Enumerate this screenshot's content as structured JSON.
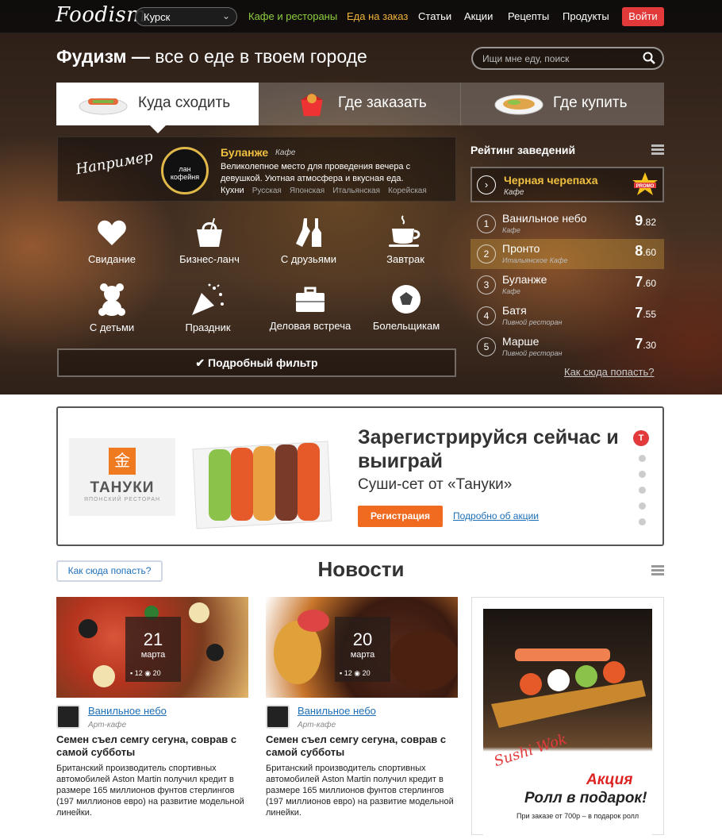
{
  "header": {
    "logo": "Foodism",
    "city": "Курск",
    "nav": [
      {
        "label": "Кафе и рестораны",
        "color": "#8ecf3e"
      },
      {
        "label": "Еда на заказ",
        "color": "#f0b43a"
      },
      {
        "label": "Статьи",
        "color": "#ffffff"
      },
      {
        "label": "Акции",
        "color": "#ffffff"
      },
      {
        "label": "Рецепты",
        "color": "#ffffff"
      },
      {
        "label": "Продукты",
        "color": "#ffffff"
      }
    ],
    "login": "Войти"
  },
  "hero": {
    "title_bold": "Фудизм —",
    "title_rest": " все о еде в твоем городе",
    "search_placeholder": "Ищи мне еду, поиск",
    "tabs": [
      {
        "label": "Куда сходить",
        "icon": "sushi-plate-icon"
      },
      {
        "label": "Где заказать",
        "icon": "takeout-box-icon"
      },
      {
        "label": "Где купить",
        "icon": "dish-plate-icon"
      }
    ],
    "example": {
      "hand_label": "Например",
      "badge_text": "лан кофейня",
      "name": "Буланже",
      "type": "Кафе",
      "desc": "Великолепное место для проведения вечера с девушкой. Уютная атмосфера и вкусная еда.",
      "cuisine_label": "Кухни",
      "cuisines": [
        "Русская",
        "Японская",
        "Итальянская",
        "Корейская"
      ]
    },
    "categories": [
      {
        "label": "Свидание",
        "icon": "heart-icon"
      },
      {
        "label": "Бизнес-ланч",
        "icon": "lunch-bag-icon"
      },
      {
        "label": "С друзьями",
        "icon": "bottles-icon"
      },
      {
        "label": "Завтрак",
        "icon": "coffee-cup-icon"
      },
      {
        "label": "С детьми",
        "icon": "teddy-bear-icon"
      },
      {
        "label": "Праздник",
        "icon": "party-popper-icon"
      },
      {
        "label": "Деловая встреча",
        "icon": "briefcase-icon"
      },
      {
        "label": "Болельщикам",
        "icon": "soccer-ball-icon"
      }
    ],
    "filter": "Подробный фильтр"
  },
  "rating": {
    "title": "Рейтинг заведений",
    "promo": {
      "name": "Черная черепаха",
      "type": "Кафе",
      "badge": "PROMO"
    },
    "rows": [
      {
        "rank": "1",
        "name": "Ванильное небо",
        "type": "Кафе",
        "score": "9",
        "dec": ".82"
      },
      {
        "rank": "2",
        "name": "Пронто",
        "type": "Итальянское Кафе",
        "score": "8",
        "dec": ".60"
      },
      {
        "rank": "3",
        "name": "Буланже",
        "type": "Кафе",
        "score": "7",
        "dec": ".60"
      },
      {
        "rank": "4",
        "name": "Батя",
        "type": "Пивной ресторан",
        "score": "7",
        "dec": ".55"
      },
      {
        "rank": "5",
        "name": "Марше",
        "type": "Пивной ресторан",
        "score": "7",
        "dec": ".30"
      }
    ],
    "howto": "Как сюда попасть?"
  },
  "banner": {
    "brand": "ТАНУКИ",
    "brand_sub": "ЯПОНСКИЙ РЕСТОРАН",
    "brand_glyph": "金",
    "title": "Зарегистрируйся сейчас и выиграй",
    "subtitle": "Суши-сет от «Тануки»",
    "button": "Регистрация",
    "link": "Подробно об акции",
    "dots_active_letter": "T"
  },
  "news": {
    "howto": "Как сюда попасть?",
    "title": "Новости",
    "cards": [
      {
        "day": "21",
        "month": "марта",
        "comments": "12",
        "views": "20",
        "source": "Ванильное небо",
        "source_type": "Арт-кафе",
        "headline": "Семен съел семгу сегуна, соврав с самой субботы",
        "text": "Британский производитель спортивных автомобилей Aston Martin получил кредит в размере 165 миллионов фунтов стерлингов (197 миллионов евро) на развитие модельной линейки."
      },
      {
        "day": "20",
        "month": "марта",
        "comments": "12",
        "views": "20",
        "source": "Ванильное небо",
        "source_type": "Арт-кафе",
        "headline": "Семен съел семгу сегуна, соврав с самой субботы",
        "text": "Британский производитель спортивных автомобилей Aston Martin получил кредит в размере 165 миллионов фунтов стерлингов (197 миллионов евро) на развитие модельной линейки."
      }
    ]
  },
  "ad": {
    "logo": "Sushi Wok",
    "akcia": "Акция",
    "headline": "Ролл в подарок!",
    "fine": "При заказе от 700р – в подарок ролл"
  },
  "colors": {
    "accent_red": "#e23a3a",
    "accent_orange": "#f06a20",
    "gold": "#f0c040",
    "link": "#1d6fb8"
  }
}
